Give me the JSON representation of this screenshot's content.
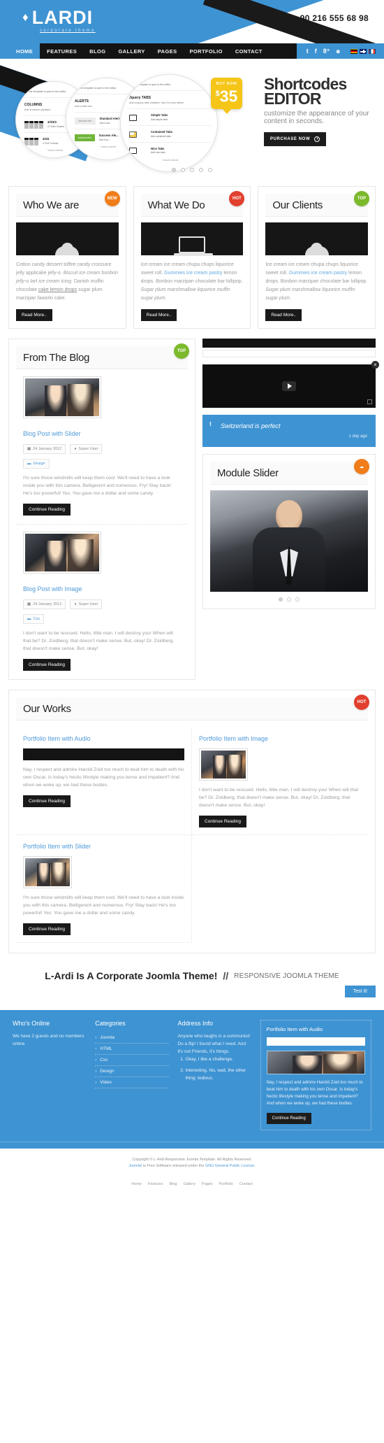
{
  "header": {
    "logo_name": "LARDI",
    "logo_tagline": "corporate theme",
    "logo_mark_icon": "droplet-icon",
    "phone_icon": "phone-icon",
    "phone": "+ 90 216 555 68 98"
  },
  "nav": {
    "home": "HOME",
    "items": [
      "FEATURES",
      "BLOG",
      "GALLERY",
      "PAGES",
      "PORTFOLIO",
      "CONTACT"
    ],
    "social": [
      {
        "name": "twitter-icon",
        "glyph": "t"
      },
      {
        "name": "facebook-icon",
        "glyph": "f"
      },
      {
        "name": "google-plus-icon",
        "glyph": "8⁺"
      },
      {
        "name": "rss-icon",
        "glyph": "๏"
      }
    ],
    "flags": [
      "flag-de-icon",
      "flag-uk-icon",
      "flag-fr-icon"
    ]
  },
  "slider": {
    "badge_label": "BUY NOW",
    "badge_currency": "$",
    "badge_price": "35",
    "title_line1": "Shortcodes",
    "title_line2": "EDITOR",
    "subtitle": "customize the appearance of your content in seconds.",
    "button_label": "PURCHASE NOW",
    "dots": 5,
    "active_dot": 1,
    "circles": [
      {
        "top_note": "...ct the template to open in the editor",
        "heading": "COLUMNS",
        "sub": "Add a column variation",
        "rows": [
          {
            "label": "3/3/3/3",
            "desc": "4 Three Column"
          },
          {
            "label": "4/4/4",
            "desc": "3 Four Column"
          }
        ],
        "footer": "* actual contents"
      },
      {
        "top_note": "...ct the template to open in the editor",
        "heading": "ALERTS",
        "sub": "Add a alert box",
        "rows": [
          {
            "tag": "standard alert",
            "label": "Standard Alert",
            "desc": "Add a sta..."
          },
          {
            "tag": "success alert",
            "label": "Success Ale...",
            "desc": "Add a su..."
          }
        ],
        "footer": "* actual contents"
      },
      {
        "top_note": "...ct the template to open in the editor",
        "heading": "Jquery TABS",
        "sub": "Add a jquery tabs variation.  Use it in your article",
        "rows": [
          {
            "label": "Simple Tabs",
            "desc": "Add simple tabs"
          },
          {
            "label": "Contained Tabs",
            "desc": "Add contained tabs"
          },
          {
            "label": "Nice Tabs",
            "desc": "Add nice tabs"
          }
        ],
        "footer": "* actual contents"
      }
    ]
  },
  "features": [
    {
      "title": "Who We are",
      "badge": "NEW",
      "badge_color": "#f07d1a",
      "image_icon": "person-icon",
      "text_parts": [
        {
          "t": "Cotton candy dessert toffee candy croissant jelly applicake jelly-o. ",
          "s": "n"
        },
        {
          "t": "Biscuit ice cream bonbon jelly-o tart ice cream icing.",
          "s": "i"
        },
        {
          "t": " Danish muffin chocolate ",
          "s": "n"
        },
        {
          "t": "cake lemon drops",
          "s": "u"
        },
        {
          "t": " sugar plum marzipan faworki cake.",
          "s": "n"
        }
      ],
      "button": "Read More.."
    },
    {
      "title": "What We Do",
      "badge": "HOT",
      "badge_color": "#e2402f",
      "image_icon": "laptop-icon",
      "text_parts": [
        {
          "t": "Ice-cream ice cream chupa chups liquorice sweet roll. ",
          "s": "n"
        },
        {
          "t": "Gummies ice cream pastry",
          "s": "a"
        },
        {
          "t": " lemon drops. Bonbon marzipan chocolate bar lollipop. ",
          "s": "n"
        },
        {
          "t": "Sugar plum marshmallow liquorice muffin sugar plum.",
          "s": "i"
        }
      ],
      "button": "Read More.."
    },
    {
      "title": "Our Clients",
      "badge": "TOP",
      "badge_color": "#7cb92c",
      "image_icon": "person-icon",
      "text_parts": [
        {
          "t": "Ice cream ice cream chupa chups liquorice sweet roll. ",
          "s": "n"
        },
        {
          "t": "Gummies ice cream pastry",
          "s": "a"
        },
        {
          "t": " lemon drops. Bonbon marzipan chocolate bar lollipop. ",
          "s": "n"
        },
        {
          "t": "Sugar plum marshmallow liquorice muffin sugar plum.",
          "s": "i"
        }
      ],
      "button": "Read More.."
    }
  ],
  "blog": {
    "title": "From The Blog",
    "badge": "TOP",
    "posts": [
      {
        "thumb": "blog-photo-1",
        "title": "Blog Post with Slider",
        "date_icon": "calendar-icon",
        "date": "24 January 2012",
        "author_icon": "user-icon",
        "author": "Super User",
        "category_icon": "folder-icon",
        "category": "Design",
        "body": "I'm sure those windmills will keep them cool. We'll need to have a look inside you with this camera. Belligerent and numerous. Fry! Stay back! He's too powerful! Yes. You gave me a dollar and some candy.",
        "button": "Continue Reading"
      },
      {
        "thumb": "blog-photo-2",
        "title": "Blog Post with Image",
        "date_icon": "calendar-icon",
        "date": "24 January 2012",
        "author_icon": "user-icon",
        "author": "Super User",
        "category_icon": "folder-icon",
        "category": "Css",
        "body": "I don't want to be rescued. Hello, little man. I will destroy you! When will that be? Dr. Zoidberg, that doesn't make sense. But, okay! Dr. Zoidberg, that doesn't make sense. But, okay!",
        "button": "Continue Reading"
      }
    ]
  },
  "sidebar": {
    "video_close_icon": "close-icon",
    "video_play_icon": "play-icon",
    "video_expand_icon": "expand-icon",
    "tweet_icon": "twitter-bird-icon",
    "tweet_text": "Switzerland is perfect",
    "tweet_time": "1 day ago",
    "module_title": "Module Slider",
    "module_badge_icon": "cloud-icon",
    "module_badge_color": "#f07d1a",
    "module_dots": 3,
    "module_active_dot": 1
  },
  "works": {
    "title": "Our Works",
    "badge": "HOT",
    "items": [
      {
        "title": "Portfolio Item with Audio",
        "media": "audio-player",
        "body": "Nay, I respect and admire Harold Zoid too much to beat him to death with his own Oscar. Is today's hectic lifestyle making you tense and impatient? And when we woke up, we had these bodies.",
        "button": "Continue Reading"
      },
      {
        "title": "Portfolio Item with Image",
        "media": "image",
        "body": "I don't want to be rescued. Hello, little man. I will destroy you! When will that be? Dr. Zoidberg, that doesn't make sense. But, okay! Dr. Zoidberg, that doesn't make sense. But, okay!",
        "button": "Continue Reading"
      },
      {
        "title": "Portfolio Item with Slider",
        "media": "slider",
        "body": "I'm sure those windmills will keep them cool. We'll need to have a look inside you with this camera. Belligerent and numerous. Fry! Stay back! He's too powerful! Yes. You gave me a dollar and some candy.",
        "button": "Continue Reading"
      }
    ]
  },
  "cta": {
    "headline": "L-Ardi Is A Corporate Joomla Theme!",
    "separator": "//",
    "subline": "RESPONSIVE JOOMLA THEME",
    "button": "Test it!"
  },
  "footer": {
    "whos_online": {
      "title": "Who's Online",
      "text": "We have 2 guests and no members online"
    },
    "categories": {
      "title": "Categories",
      "items": [
        "Joomla",
        "HTML",
        "Css",
        "Design",
        "Video"
      ]
    },
    "address": {
      "title": "Address Info",
      "text": "Anyone who laughs is a communist! Do a flip! I found what I need. And it's not Friends, it's things.",
      "list": [
        "Okay, I like a challenge.",
        "Interesting. No, wait, the other thing: tedious."
      ]
    },
    "card": {
      "title": "Portfolio Item with Audio",
      "media": "audio-player",
      "body": "Nay, I respect and admire Harold Zoid too much to beat him to death with his own Oscar. Is today's hectic lifestyle making you tense and impatient? And when we woke up, we had these bodies.",
      "button": "Continue Reading"
    }
  },
  "copyright": {
    "line1": "Copyright © L-Ardi Responsive Joomla Template. All Rights Reserved.",
    "line2_pre": "Joomla! ",
    "line2_mid": "is Free Software released under the ",
    "line2_link": "GNU General Public License.",
    "nav": [
      "Home",
      "Features",
      "Blog",
      "Gallery",
      "Pages",
      "Portfolio",
      "Contact"
    ]
  },
  "colors": {
    "brand_blue": "#3e93d2",
    "dark": "#141414",
    "accent_yellow": "#f5c518",
    "badge_orange": "#f07d1a",
    "badge_red": "#e2402f",
    "badge_green": "#7cb92c",
    "link_blue": "#4f9ad8"
  }
}
